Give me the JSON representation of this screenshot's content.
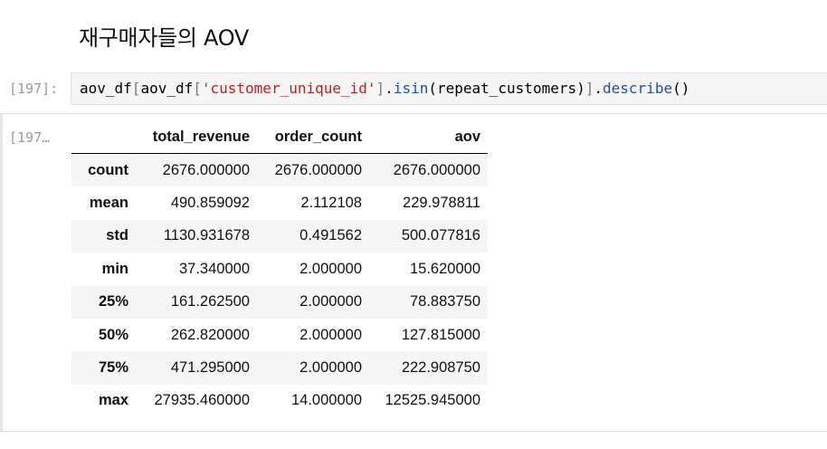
{
  "markdown": {
    "title": "재구매자들의 AOV"
  },
  "input_cell": {
    "prompt": "[197]:",
    "code": {
      "part1": "aov_df",
      "part2": "[",
      "part3": "aov_df",
      "part4": "[",
      "part5": "'customer_unique_id'",
      "part6": "]",
      "part7": ".",
      "part8": "isin",
      "part9": "(repeat_customers)",
      "part10": "]",
      "part11": ".",
      "part12": "describe",
      "part13": "()"
    }
  },
  "output_cell": {
    "prompt": "[197…",
    "table": {
      "columns": [
        "",
        "total_revenue",
        "order_count",
        "aov"
      ],
      "rows": [
        {
          "label": "count",
          "total_revenue": "2676.000000",
          "order_count": "2676.000000",
          "aov": "2676.000000"
        },
        {
          "label": "mean",
          "total_revenue": "490.859092",
          "order_count": "2.112108",
          "aov": "229.978811"
        },
        {
          "label": "std",
          "total_revenue": "1130.931678",
          "order_count": "0.491562",
          "aov": "500.077816"
        },
        {
          "label": "min",
          "total_revenue": "37.340000",
          "order_count": "2.000000",
          "aov": "15.620000"
        },
        {
          "label": "25%",
          "total_revenue": "161.262500",
          "order_count": "2.000000",
          "aov": "78.883750"
        },
        {
          "label": "50%",
          "total_revenue": "262.820000",
          "order_count": "2.000000",
          "aov": "127.815000"
        },
        {
          "label": "75%",
          "total_revenue": "471.295000",
          "order_count": "2.000000",
          "aov": "222.908750"
        },
        {
          "label": "max",
          "total_revenue": "27935.460000",
          "order_count": "14.000000",
          "aov": "12525.945000"
        }
      ]
    }
  },
  "colors": {
    "string": "#ba2121",
    "method": "#1f4fa5",
    "prompt": "#9a9a9a",
    "stripe": "#f5f5f5"
  }
}
